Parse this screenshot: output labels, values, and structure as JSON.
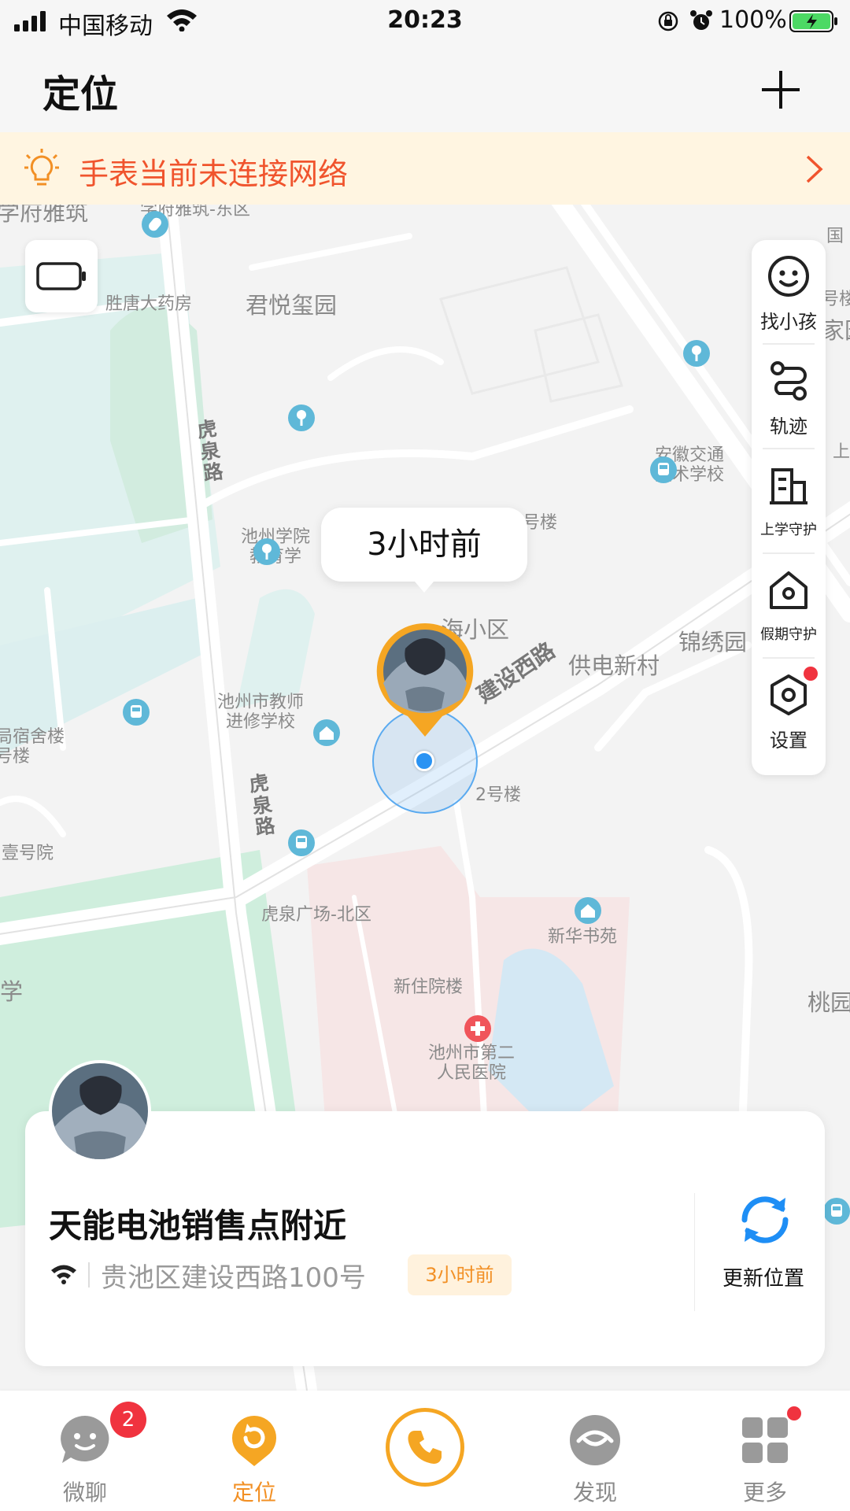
{
  "status_bar": {
    "carrier": "中国移动",
    "time": "20:23",
    "battery_percent": "100%"
  },
  "header": {
    "title": "定位"
  },
  "notice": {
    "text": "手表当前未连接网络"
  },
  "map": {
    "labels": {
      "xuefu_top_left": "学府雅筑",
      "xuefu_east": "学府雅筑-东区",
      "shengtang": "胜唐大药房",
      "junyue": "君悦玺园",
      "hu_quan_rd_1": "虎泉路",
      "hu_quan_rd_2": "虎泉路",
      "anhui_jiaotong": "安徽交通\n技术学校",
      "chizhou_college": "池州学院\n教育学",
      "lou": "号楼",
      "xiaoqu": "海小区",
      "jianshe_xi_rd": "建设西路",
      "gongdian": "供电新村",
      "jinxiu": "锦绣园",
      "teacher_school": "池州市教师\n进修学校",
      "dormitory": "局宿舍楼\n号楼",
      "building_2": "2号楼",
      "yihaoyuan": "壹号院",
      "huquan_plaza": "虎泉广场-北区",
      "xinhua": "新华书苑",
      "inpatient": "新住院楼",
      "hospital": "池州市第二\n人民医院",
      "xue": "学",
      "taoyuan": "桃园",
      "right_edge_1": "国",
      "right_edge_2": "号楼",
      "right_edge_3": "家园",
      "right_edge_4": "上林"
    },
    "time_bubble": "3小时前",
    "tools": [
      {
        "label": "找小孩",
        "icon": "smiley-icon"
      },
      {
        "label": "轨迹",
        "icon": "route-icon"
      },
      {
        "label": "上学守护",
        "icon": "school-building-icon"
      },
      {
        "label": "假期守护",
        "icon": "home-shield-icon"
      },
      {
        "label": "设置",
        "icon": "settings-hexagon-icon"
      }
    ]
  },
  "card": {
    "place": "天能电池销售点附近",
    "address": "贵池区建设西路100号",
    "tag": "3小时前",
    "refresh_label": "更新位置"
  },
  "tabbar": {
    "tabs": [
      {
        "label": "微聊",
        "badge": "2"
      },
      {
        "label": "定位"
      },
      {
        "label": ""
      },
      {
        "label": "发现"
      },
      {
        "label": "更多"
      }
    ]
  },
  "colors": {
    "accent": "#f29025",
    "notice_text": "#f0542d",
    "notice_bg": "#fff5e1",
    "location_blue": "#2a93f3",
    "badge_red": "#f0333f"
  }
}
